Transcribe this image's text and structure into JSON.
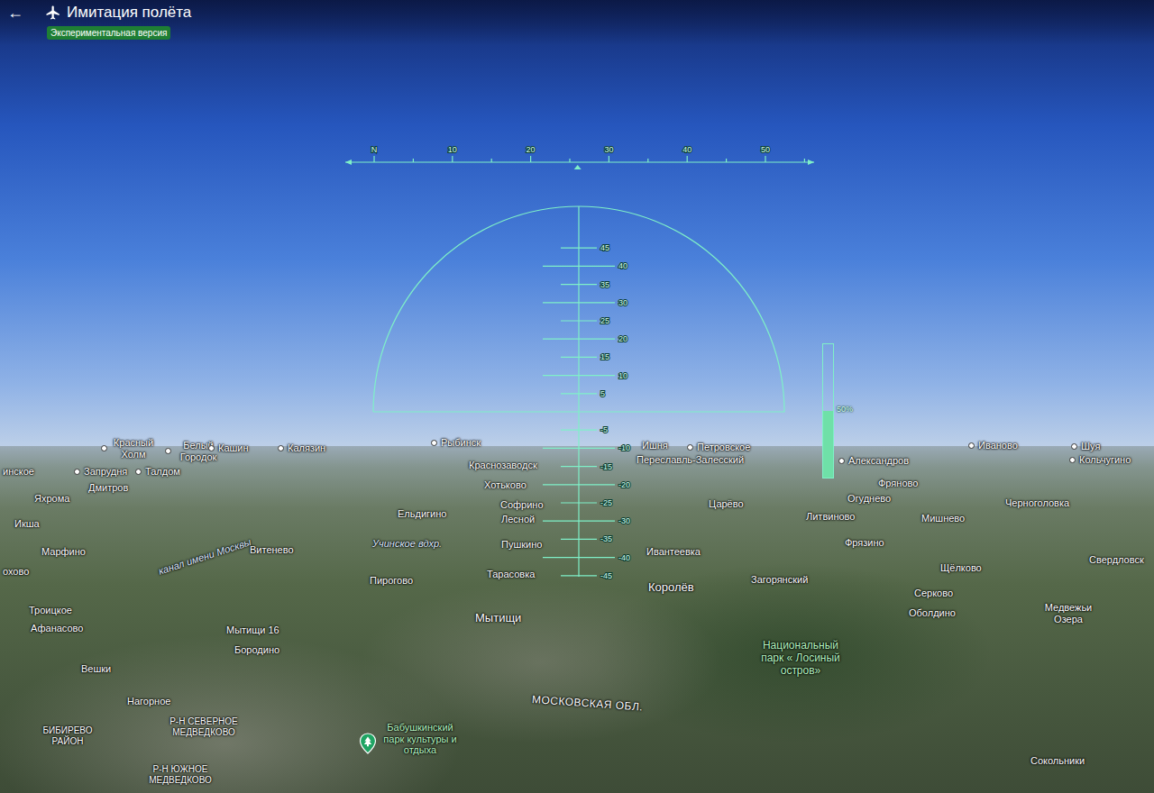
{
  "app": {
    "back": "←",
    "title": "Имитация полёта",
    "badge": "Экспериментальная версия"
  },
  "heading_tape": {
    "heading": 26,
    "marks": [
      "N",
      "10",
      "20",
      "30",
      "40",
      "50"
    ]
  },
  "pitch_ladder": {
    "marks": [
      "45",
      "40",
      "35",
      "30",
      "25",
      "20",
      "15",
      "10",
      "5",
      "-5",
      "-10",
      "-15",
      "-20",
      "-25",
      "-30",
      "-35",
      "-40",
      "-45"
    ]
  },
  "throttle": {
    "level": 0.5,
    "reading": "50%"
  },
  "map_labels": [
    {
      "text": "Красный Холм",
      "kind": "town"
    },
    {
      "text": "Белый Городок",
      "kind": "town"
    },
    {
      "text": "Кашин",
      "kind": "town"
    },
    {
      "text": "Калязин",
      "kind": "town"
    },
    {
      "text": "Рыбинск",
      "kind": "town"
    },
    {
      "text": "Ишня",
      "kind": "place"
    },
    {
      "text": "Петровское",
      "kind": "town"
    },
    {
      "text": "Иваново",
      "kind": "town"
    },
    {
      "text": "Шуя",
      "kind": "town"
    },
    {
      "text": "Кольчугино",
      "kind": "town"
    },
    {
      "text": "Переславль-Залесский",
      "kind": "place"
    },
    {
      "text": "Александров",
      "kind": "town"
    },
    {
      "text": "инское",
      "kind": "place"
    },
    {
      "text": "Запрудня",
      "kind": "town"
    },
    {
      "text": "Талдом",
      "kind": "town"
    },
    {
      "text": "Краснозаводск",
      "kind": "place"
    },
    {
      "text": "Дмитров",
      "kind": "place"
    },
    {
      "text": "Хотьково",
      "kind": "place"
    },
    {
      "text": "Фряново",
      "kind": "place"
    },
    {
      "text": "Яхрома",
      "kind": "place"
    },
    {
      "text": "Софрино",
      "kind": "place"
    },
    {
      "text": "Огуднево",
      "kind": "place"
    },
    {
      "text": "Царёво",
      "kind": "place"
    },
    {
      "text": "Черноголовка",
      "kind": "place"
    },
    {
      "text": "Ельдигино",
      "kind": "place"
    },
    {
      "text": "Лесной",
      "kind": "place"
    },
    {
      "text": "Литвиново",
      "kind": "place"
    },
    {
      "text": "Мишнево",
      "kind": "place"
    },
    {
      "text": "Икша",
      "kind": "place"
    },
    {
      "text": "Фрязино",
      "kind": "place"
    },
    {
      "text": "Учинское вдхр.",
      "kind": "water"
    },
    {
      "text": "Пушкино",
      "kind": "place"
    },
    {
      "text": "Ивантеевка",
      "kind": "place"
    },
    {
      "text": "Марфино",
      "kind": "place"
    },
    {
      "text": "Витенево",
      "kind": "place"
    },
    {
      "text": "охово",
      "kind": "place"
    },
    {
      "text": "канал имени Москвы",
      "kind": "water"
    },
    {
      "text": "Свердловск",
      "kind": "place"
    },
    {
      "text": "Щёлково",
      "kind": "place"
    },
    {
      "text": "Тарасовка",
      "kind": "place"
    },
    {
      "text": "Пирогово",
      "kind": "place"
    },
    {
      "text": "Загорянский",
      "kind": "place"
    },
    {
      "text": "Королёв",
      "kind": "city"
    },
    {
      "text": "Серково",
      "kind": "place"
    },
    {
      "text": "Медвежьи Озера",
      "kind": "place"
    },
    {
      "text": "Троицкое",
      "kind": "place"
    },
    {
      "text": "Оболдино",
      "kind": "place"
    },
    {
      "text": "Мытищи",
      "kind": "city"
    },
    {
      "text": "Афанасово",
      "kind": "place"
    },
    {
      "text": "Мытищи 16",
      "kind": "place"
    },
    {
      "text": "Бородино",
      "kind": "place"
    },
    {
      "text": "Национальный парк « Лосиный остров»",
      "kind": "park"
    },
    {
      "text": "Вешки",
      "kind": "place"
    },
    {
      "text": "МОСКОВСКАЯ ОБЛ.",
      "kind": "boundary"
    },
    {
      "text": "Нагорное",
      "kind": "place"
    },
    {
      "text": "Р-Н СЕВЕРНОЕ МЕДВЕДКОВО",
      "kind": "district"
    },
    {
      "text": "БИБИРЕВО РАЙОН",
      "kind": "district"
    },
    {
      "text": "Бабушкинский парк культуры и отдыха",
      "kind": "park_pin"
    },
    {
      "text": "Р-Н ЮЖНОЕ МЕДВЕДКОВО",
      "kind": "district"
    },
    {
      "text": "Сокольники",
      "kind": "place"
    }
  ]
}
